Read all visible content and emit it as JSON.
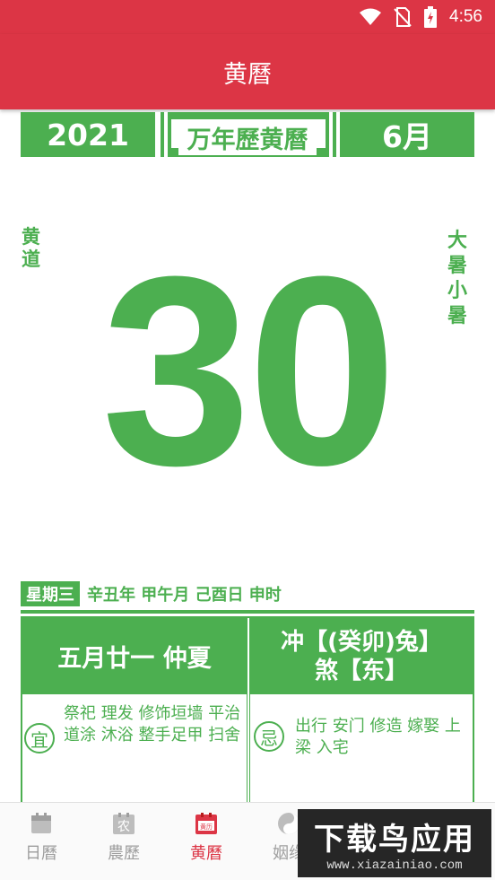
{
  "status_bar": {
    "time": "4:56",
    "wifi_icon": "wifi-icon",
    "sim_icon": "no-sim-icon",
    "battery_icon": "battery-charging-icon"
  },
  "app_bar": {
    "title": "黄曆"
  },
  "calendar_header": {
    "year": "2021",
    "title": "万年歷黄曆",
    "month": "6月"
  },
  "day": {
    "number": "30",
    "left_label": [
      "黄",
      "道"
    ],
    "right_label": [
      "大",
      "暑",
      "小",
      "暑"
    ]
  },
  "info": {
    "weekday": "星期三",
    "ganzhi": "辛丑年 甲午月 己酉日 申时"
  },
  "details": {
    "lunar_date": "五月廿一 仲夏",
    "chong": "冲【(癸卯)兔】",
    "sha": "煞【东】",
    "yi_label": "宜",
    "yi_text": "祭祀 理发 修饰垣墙 平治道涂 沐浴 整手足甲 扫舍",
    "ji_label": "忌",
    "ji_text": "出行 安门 修造 嫁娶 上梁 入宅"
  },
  "bottom_nav": [
    {
      "label": "日曆",
      "icon": "calendar-icon"
    },
    {
      "label": "農歷",
      "icon": "lunar-icon"
    },
    {
      "label": "黄曆",
      "icon": "almanac-icon"
    },
    {
      "label": "姻缘",
      "icon": "yin-yang-icon"
    }
  ],
  "watermark": {
    "line1": "下载鸟应用",
    "line2": "www.xiazainiao.com"
  },
  "colors": {
    "red": "#dc3545",
    "green": "#4caf50"
  }
}
